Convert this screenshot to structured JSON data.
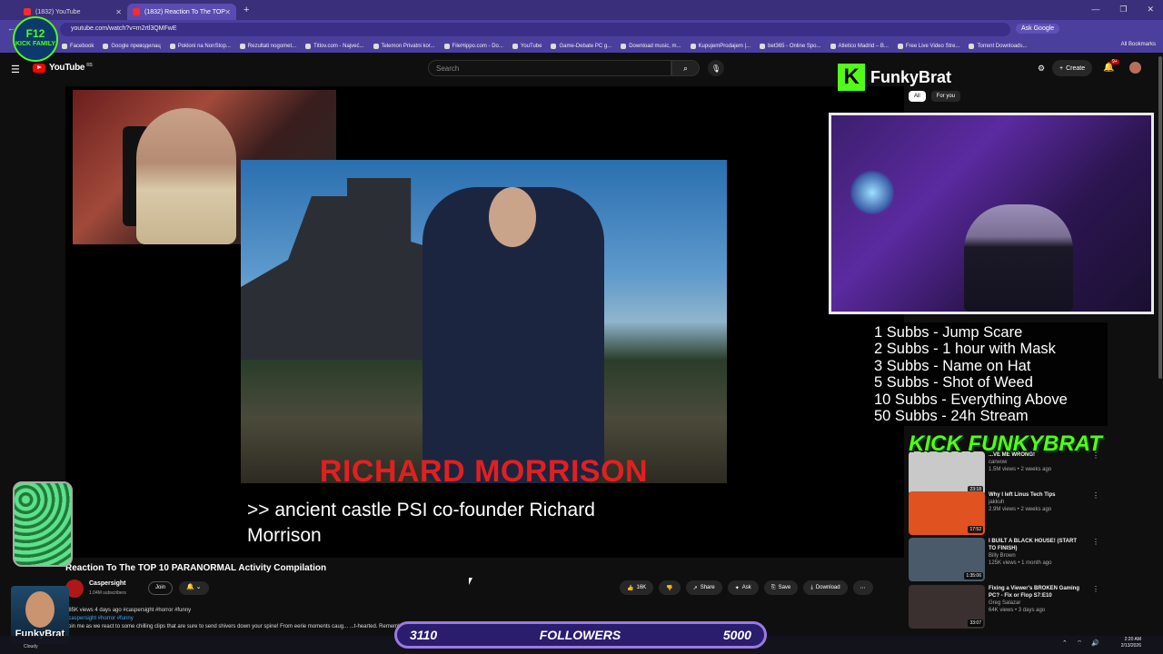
{
  "browser": {
    "tabs": [
      {
        "title": "(1832) YouTube",
        "active": false
      },
      {
        "title": "(1832) Reaction To The TOP",
        "active": true
      }
    ],
    "url": "youtube.com/watch?v=m2rtl3QMFwE",
    "ask_google": "Ask Google",
    "bookmarks": [
      "Facebook",
      "Google преводилац",
      "Pokloni na NonStop...",
      "Rezultati nogomet...",
      "Titlov.com - Najveć...",
      "Telemon Privatni kor...",
      "FileHippo.com - Do...",
      "YouTube",
      "Game-Debate PC g...",
      "Download music, m...",
      "KupujemProdajem |...",
      "bet365 - Online Spo...",
      "Atletico Madrid – B...",
      "Free Live Video Stre...",
      "Torrent Downloads..."
    ],
    "all_bookmarks": "All Bookmarks"
  },
  "youtube": {
    "logo": "YouTube",
    "region": "RS",
    "search_placeholder": "Search",
    "create": "Create",
    "notifications": "9+",
    "chips": [
      "All",
      "For you"
    ]
  },
  "video": {
    "name_plate": "RICHARD MORRISON",
    "caption": ">> ancient castle PSI co-founder Richard Morrison",
    "title": "Reaction To The TOP 10 PARANORMAL Activity Compilation",
    "channel": "Caspersight",
    "subscribers": "1.04M subscribers",
    "join": "Join",
    "likes": "16K",
    "share": "Share",
    "ask": "Ask",
    "save": "Save",
    "download": "Download",
    "views_line": "185K views  4 days ago  #caspersight #horror #funny",
    "tags": "#caspersight #horror #funny",
    "description": "Join me as we react to some chilling clips that are sure to send shivers down your spine! From eerie moments caug...                      ...t-hearted. Remember, don't watch al...                    ...know what you think below!"
  },
  "overlay": {
    "streamer": "FunkyBrat",
    "kick_letter": "K",
    "sub_goals": [
      "1 Subbs - Jump Scare",
      "2 Subbs - 1 hour with Mask",
      "3 Subbs - Name on Hat",
      "5 Subbs - Shot of Weed",
      "10 Subbs - Everything Above",
      "50 Subbs - 24h Stream"
    ],
    "kick_banner": "KICK FUNKYBRAT",
    "logo_top": "F12",
    "logo_bottom": "KICK FAMILY",
    "avatar_name": "FunkyBrat",
    "weather": "Cloudy",
    "followers_current": "3110",
    "followers_label": "FOLLOWERS",
    "followers_goal": "5000"
  },
  "recommendations": [
    {
      "title": "...VE ME WRONG!",
      "channel": "carwow",
      "meta": "1.5M views • 2 weeks ago",
      "duration": "23:18",
      "color": "#c9c9c9"
    },
    {
      "title": "Why I left Linus Tech Tips",
      "channel": "jakkuh",
      "meta": "2.9M views • 2 weeks ago",
      "duration": "17:52",
      "color": "#e0521f"
    },
    {
      "title": "I BUILT A BLACK HOUSE! (START TO FINISH)",
      "channel": "Billy Brown",
      "meta": "125K views • 1 month ago",
      "duration": "1:35:06",
      "color": "#4a5a6a"
    },
    {
      "title": "Fixing a Viewer's BROKEN Gaming PC? - Fix or Flop S7:E10",
      "channel": "Greg Salazar",
      "meta": "64K views • 3 days ago",
      "duration": "33:07",
      "color": "#3a3030"
    }
  ],
  "system": {
    "time": "2:20 AM",
    "date": "2/13/2026"
  }
}
